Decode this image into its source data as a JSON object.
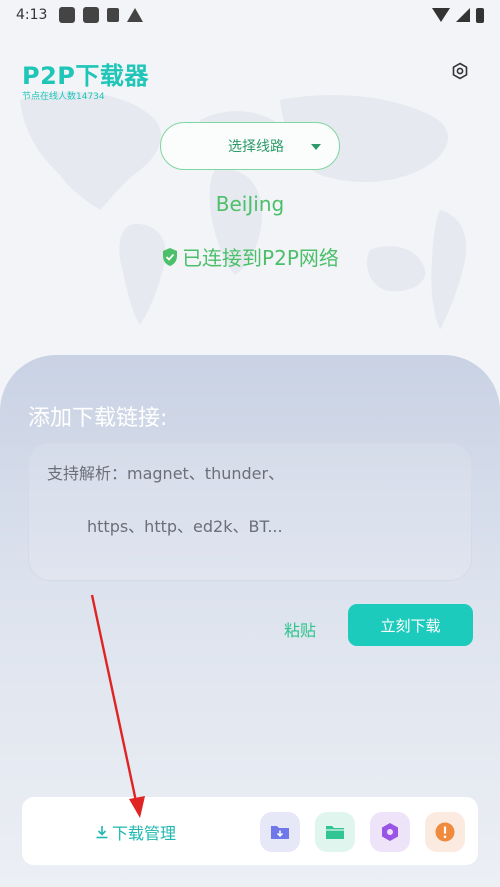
{
  "status_bar": {
    "time": "4:13"
  },
  "header": {
    "title": "P2P下载器",
    "node_count": "节点在线人数14734"
  },
  "route": {
    "select_label": "选择线路",
    "location": "BeiJing",
    "connected_text": "已连接到P2P网络"
  },
  "panel": {
    "title": "添加下载链接:",
    "input_line1": "支持解析：magnet、thunder、",
    "input_line2": "https、http、ed2k、BT..."
  },
  "actions": {
    "paste_label": "粘贴",
    "download_now_label": "立刻下载"
  },
  "bottom": {
    "download_manage_label": "下载管理"
  },
  "colors": {
    "accent": "#1dcbbd",
    "connected": "#4cbf6a",
    "annotation_arrow": "#e02424"
  }
}
